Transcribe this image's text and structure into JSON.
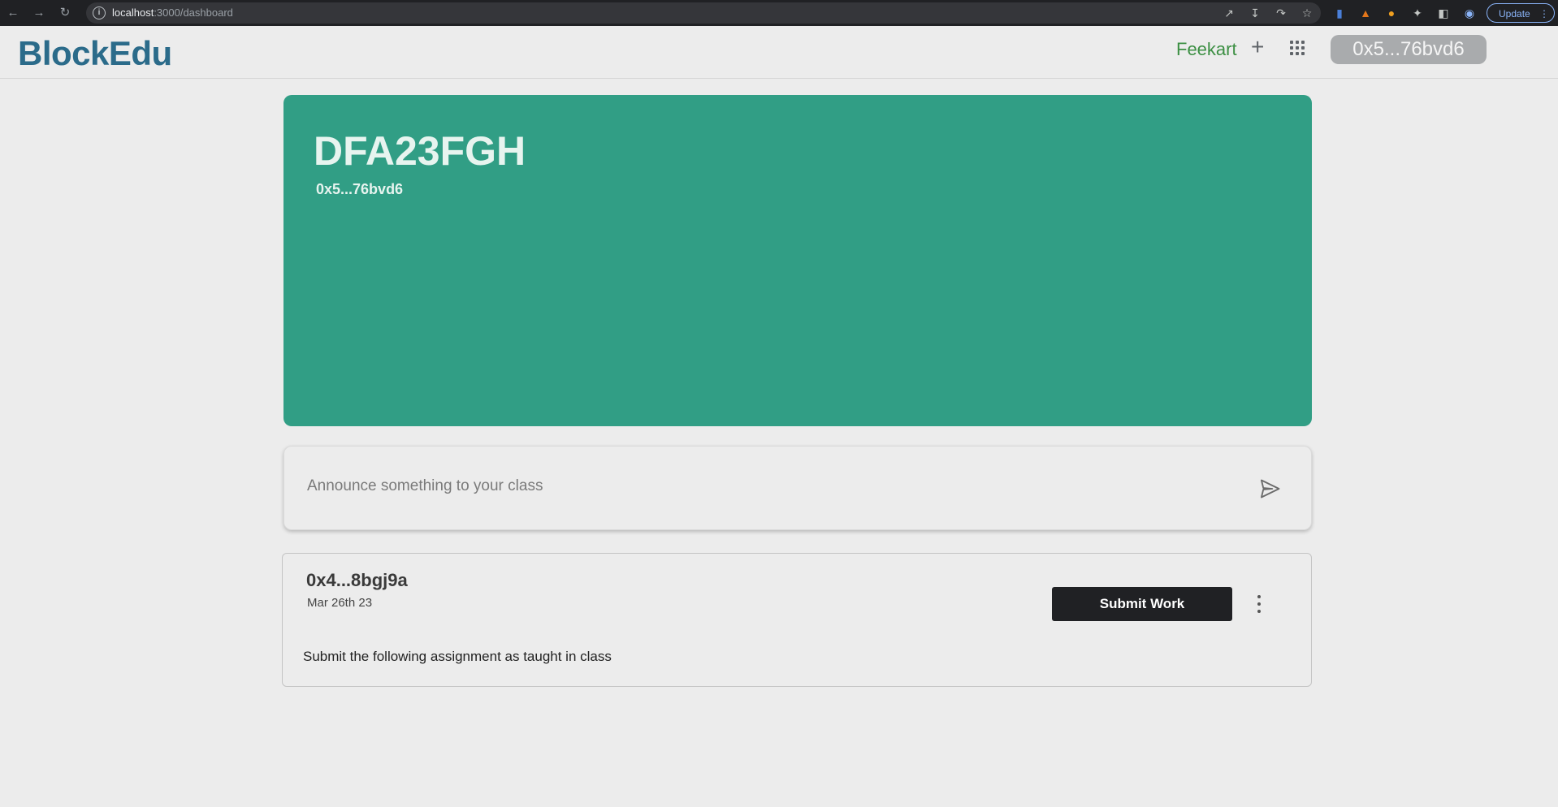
{
  "browser": {
    "url_host": "localhost",
    "url_path": ":3000/dashboard",
    "update_label": "Update"
  },
  "header": {
    "logo": "BlockEdu",
    "user_name": "Feekart",
    "add_label": "+",
    "account": "0x5...76bvd6"
  },
  "banner": {
    "class_code": "DFA23FGH",
    "owner": "0x5...76bvd6",
    "color": "#319e85"
  },
  "announce": {
    "placeholder": "Announce something to your class",
    "value": ""
  },
  "post": {
    "author": "0x4...8bgj9a",
    "date": "Mar 26th 23",
    "action_label": "Submit Work",
    "text": "Submit the following assignment as taught in class"
  },
  "icons": {
    "send": "send-icon",
    "apps": "apps-grid-icon",
    "more": "more-vert-icon"
  }
}
